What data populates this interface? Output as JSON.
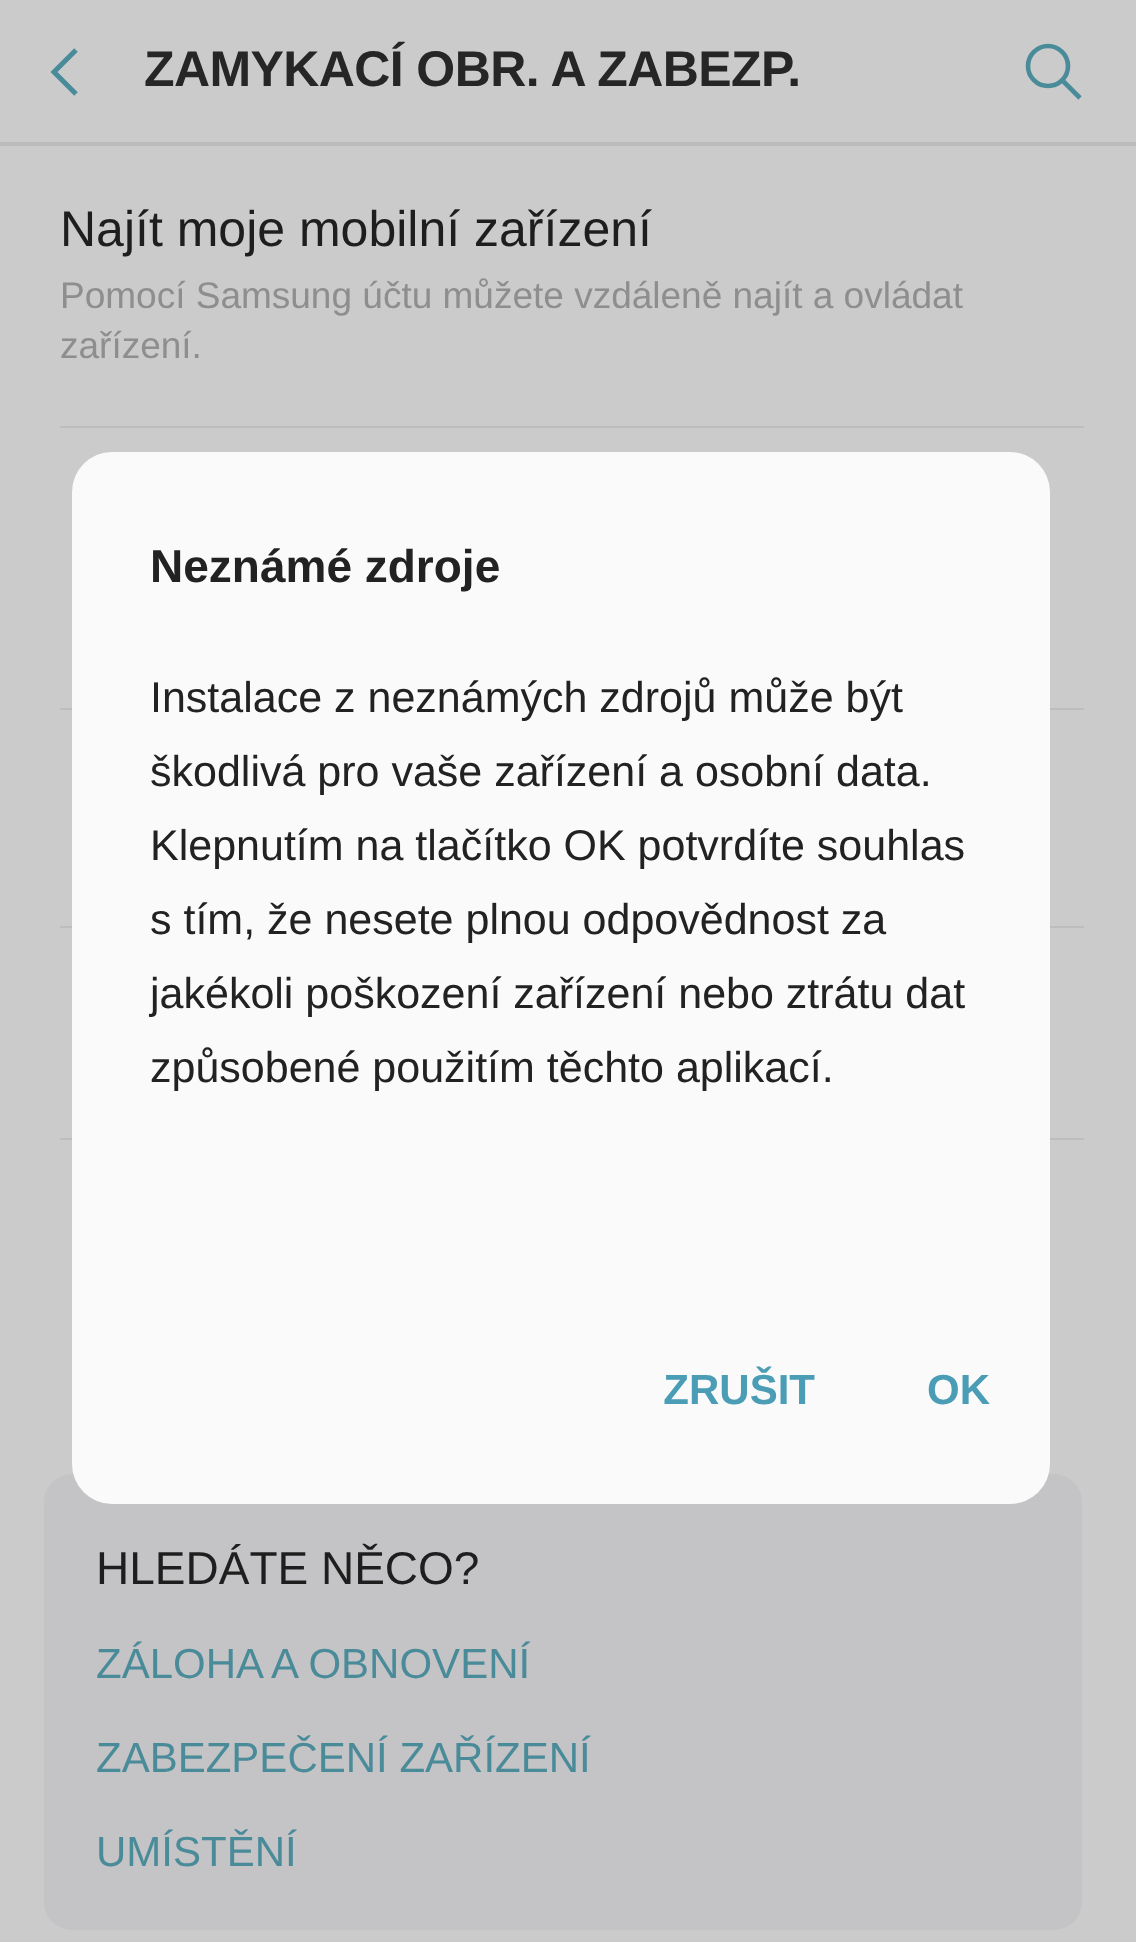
{
  "header": {
    "title": "ZAMYKACÍ OBR. A ZABEZP."
  },
  "settings": [
    {
      "title": "Najít moje mobilní zařízení",
      "summary": "Pomocí Samsung účtu můžete vzdáleně najít a ovládat zařízení."
    }
  ],
  "dialog": {
    "title": "Neznámé zdroje",
    "message": "Instalace z neznámých zdrojů může být škodlivá pro vaše zařízení a osobní data. Klepnutím na tlačítko OK potvrdíte souhlas s tím, že nesete plnou odpovědnost za jakékoli poškození zařízení nebo ztrátu dat způsobené použitím těchto aplikací.",
    "buttons": [
      "ZRUŠIT",
      "OK"
    ]
  },
  "suggestions": {
    "heading": "HLEDÁTE NĚCO?",
    "links": [
      "ZÁLOHA A OBNOVENÍ",
      "ZABEZPEČENÍ ZAŘÍZENÍ",
      "UMÍSTĚNÍ"
    ]
  }
}
